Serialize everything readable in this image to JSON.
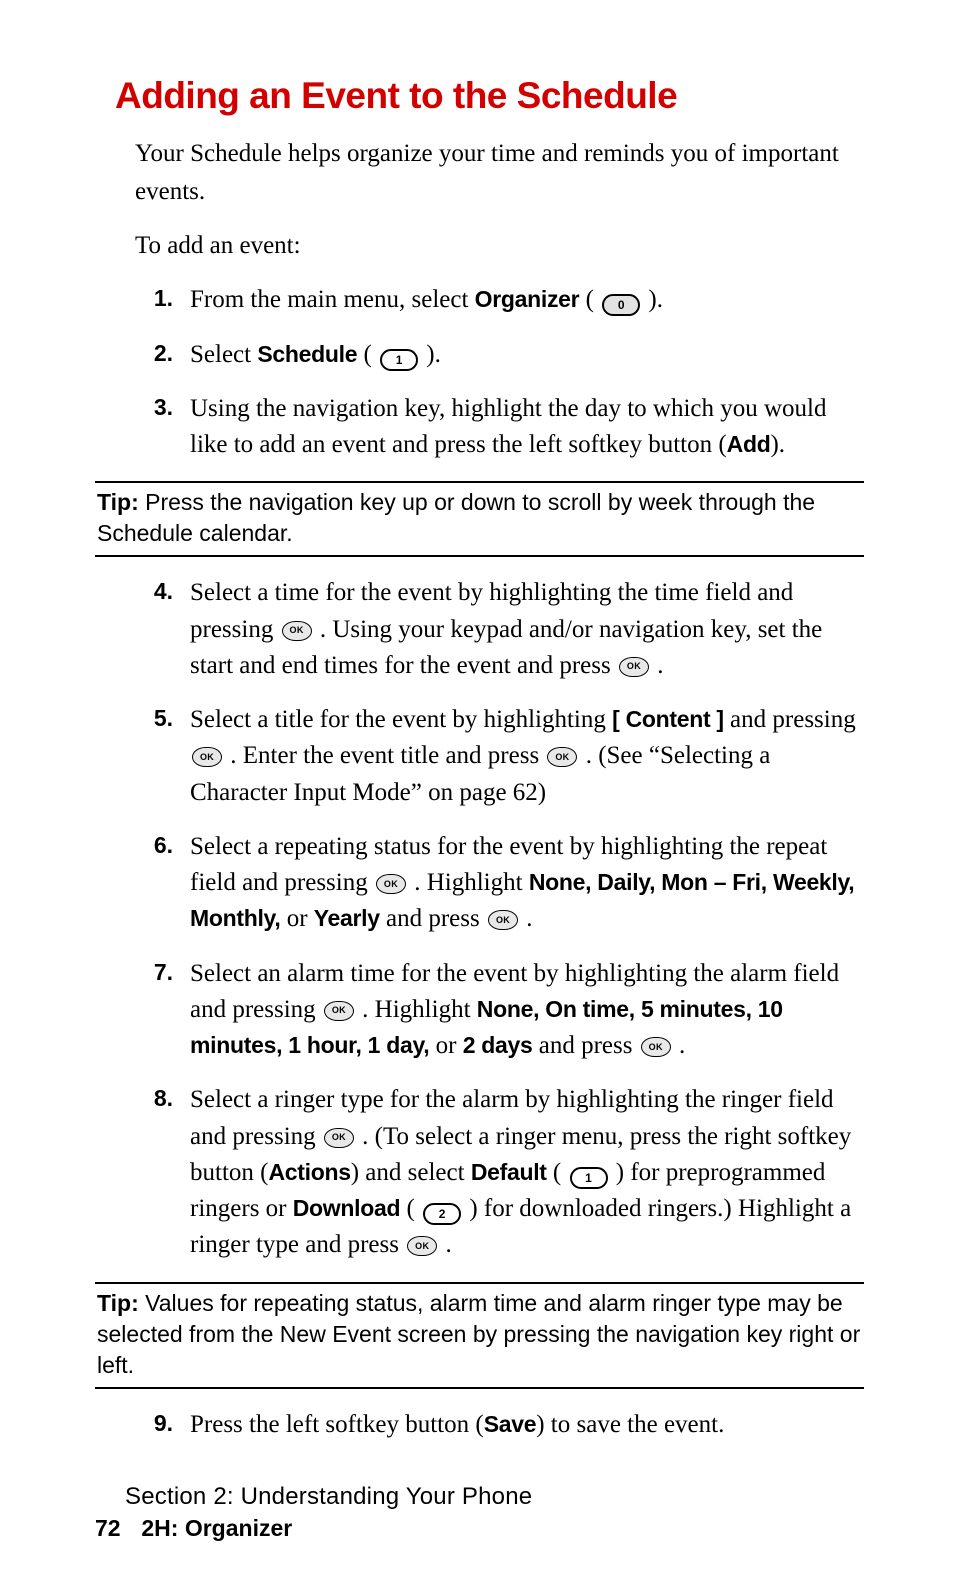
{
  "title": "Adding an Event to the Schedule",
  "intro": "Your Schedule helps organize your time and reminds you of important events.",
  "lead": "To add an event:",
  "keys": {
    "zero": "0",
    "one": "1",
    "two": "2",
    "ok": "OK"
  },
  "steps": {
    "s1": {
      "num": "1.",
      "a": "From the main menu, select ",
      "b_organizer": "Organizer",
      "c": " ( ",
      "d": " )."
    },
    "s2": {
      "num": "2.",
      "a": "Select ",
      "b_schedule": "Schedule",
      "c": " ( ",
      "d": " )."
    },
    "s3": {
      "num": "3.",
      "a": "Using the navigation key, highlight the day to which you would like to add an event and press the left softkey button (",
      "b_add": "Add",
      "c": ")."
    },
    "s4": {
      "num": "4.",
      "a": "Select a time for the event by highlighting the time field and pressing ",
      "b": " . Using your keypad and/or navigation key, set the start and end times for the event and press ",
      "c": " ."
    },
    "s5": {
      "num": "5.",
      "a": "Select a title for the event by highlighting ",
      "b_content": "[ Content ]",
      "c": " and pressing ",
      "d": " . Enter the event title and press ",
      "e": " . (See “Selecting a Character Input Mode” on page 62)"
    },
    "s6": {
      "num": "6.",
      "a": "Select a repeating status for the event by highlighting the repeat field and pressing ",
      "b": " . Highlight ",
      "c_opts": "None, Daily, Mon – Fri, Weekly, Monthly,",
      "d": " or ",
      "e_yearly": "Yearly",
      "f": " and press ",
      "g": " ."
    },
    "s7": {
      "num": "7.",
      "a": "Select an alarm time for the event by highlighting the alarm field and pressing ",
      "b": " . Highlight ",
      "c_opts": "None, On time, 5 minutes, 10 minutes, 1 hour, 1 day,",
      "d": " or ",
      "e_2days": "2 days",
      "f": " and press ",
      "g": " ."
    },
    "s8": {
      "num": "8.",
      "a": "Select a ringer type for the alarm by highlighting the ringer field and pressing ",
      "b": " . (To select a ringer menu, press the right softkey button (",
      "c_actions": "Actions",
      "d": ") and select ",
      "e_default": "Default",
      "f": " ( ",
      "g": " ) for preprogrammed ringers or ",
      "h_download": "Download",
      "i": " ( ",
      "j": " ) for downloaded ringers.) Highlight a ringer type and press ",
      "k": " ."
    },
    "s9": {
      "num": "9.",
      "a": "Press the left softkey button (",
      "b_save": "Save",
      "c": ") to save the event."
    }
  },
  "tip1": {
    "label": "Tip:",
    "text": " Press the navigation key up or down to scroll by week through the Schedule calendar."
  },
  "tip2": {
    "label": "Tip:",
    "text": " Values for repeating status, alarm time and alarm ringer type may be selected from the New Event screen by pressing the navigation key right or left."
  },
  "footer": {
    "section": "Section 2: Understanding Your Phone",
    "page": "72",
    "chapter": "2H: Organizer"
  }
}
